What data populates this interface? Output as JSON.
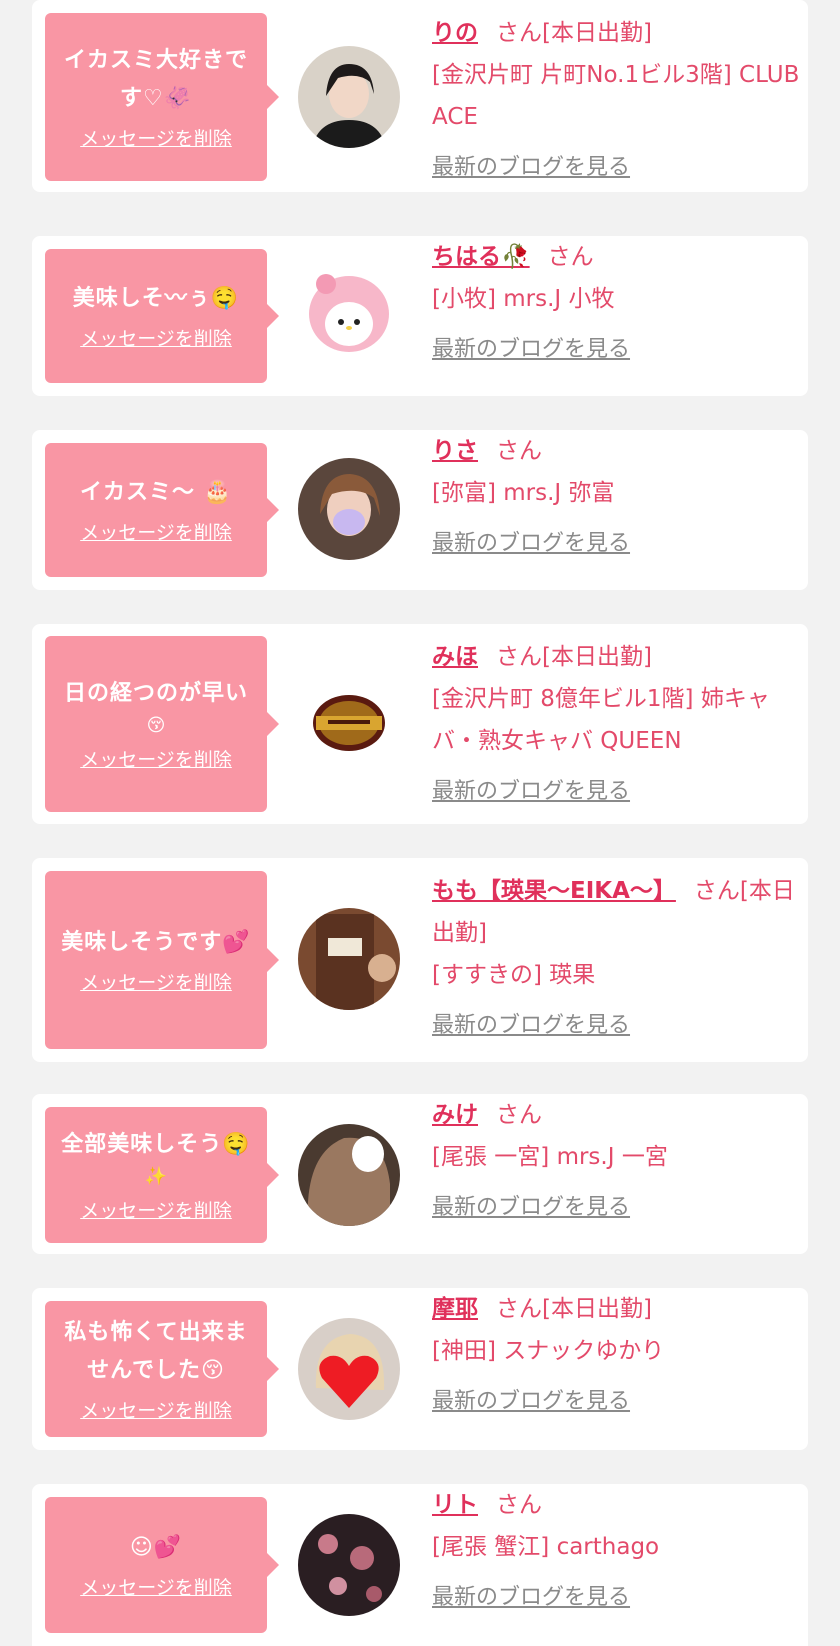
{
  "delete_label": "メッセージを削除",
  "blog_label": "最新のブログを見る",
  "san_label": "さん",
  "colors": {
    "bubble": "#f996a4",
    "name": "#e0305b",
    "shop": "#e34a6a",
    "blog": "#8a8a8a"
  },
  "items": [
    {
      "message": "イカスミ大好きです♡🦑",
      "name": "りの",
      "suffix": "[本日出勤]",
      "shop": "[金沢片町 片町No.1ビル3階] CLUB ACE",
      "avatar_icon": "woman-portrait-icon"
    },
    {
      "message": "美味しそ〰ぅ🤤",
      "name": "ちはる🥀",
      "suffix": "",
      "shop": "[小牧] mrs.J 小牧",
      "avatar_icon": "plush-toy-icon"
    },
    {
      "message": "イカスミ〜 🎂",
      "name": "りさ",
      "suffix": "",
      "shop": "[弥富] mrs.J 弥富",
      "avatar_icon": "woman-portrait-icon"
    },
    {
      "message": "日の経つのが早い",
      "message_sub": "😚",
      "name": "みほ",
      "suffix": "[本日出勤]",
      "shop": "[金沢片町 8億年ビル1階] 姉キャバ・熟女キャバ QUEEN",
      "avatar_icon": "queen-logo-icon"
    },
    {
      "message": "美味しそうです💕",
      "name": "もも【瑛果〜EIKA〜】",
      "suffix": "[本日出勤]",
      "shop": "[すすきの] 瑛果",
      "avatar_icon": "door-photo-icon"
    },
    {
      "message": "全部美味しそう🤤",
      "message_sub": "✨",
      "name": "みけ",
      "suffix": "",
      "shop": "[尾張 一宮] mrs.J 一宮",
      "avatar_icon": "woman-portrait-icon"
    },
    {
      "message": "私も怖くて出来ませんでした😚",
      "name": "摩耶",
      "suffix": "[本日出勤]",
      "shop": "[神田] スナックゆかり",
      "avatar_icon": "heart-covered-portrait-icon"
    },
    {
      "message": "☺💕",
      "name": "リト",
      "suffix": "",
      "shop": "[尾張 蟹江] carthago",
      "avatar_icon": "floral-photo-icon"
    }
  ]
}
